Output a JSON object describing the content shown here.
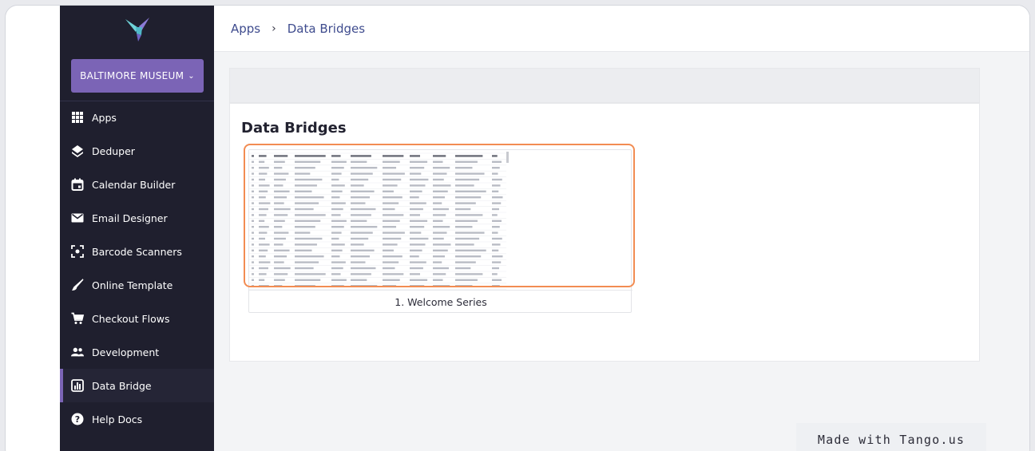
{
  "sidebar": {
    "org_name": "BALTIMORE MUSEUM",
    "items": [
      {
        "label": "Apps",
        "icon": "grid-icon"
      },
      {
        "label": "Deduper",
        "icon": "layers-icon"
      },
      {
        "label": "Calendar Builder",
        "icon": "calendar-icon"
      },
      {
        "label": "Email Designer",
        "icon": "mail-icon"
      },
      {
        "label": "Barcode Scanners",
        "icon": "scan-icon"
      },
      {
        "label": "Online Template",
        "icon": "brush-icon"
      },
      {
        "label": "Checkout Flows",
        "icon": "cart-icon"
      },
      {
        "label": "Development",
        "icon": "people-icon"
      },
      {
        "label": "Data Bridge",
        "icon": "bar-chart-icon",
        "active": true
      },
      {
        "label": "Help Docs",
        "icon": "help-icon"
      }
    ]
  },
  "breadcrumb": {
    "root": "Apps",
    "current": "Data Bridges"
  },
  "main": {
    "title": "Data Bridges",
    "cards": [
      {
        "caption": "1. Welcome Series"
      }
    ]
  },
  "watermark": "Made with Tango.us",
  "colors": {
    "sidebar_bg": "#1f1f2e",
    "accent": "#7b64b6",
    "highlight": "#f28c52",
    "link": "#3f4c8e"
  }
}
